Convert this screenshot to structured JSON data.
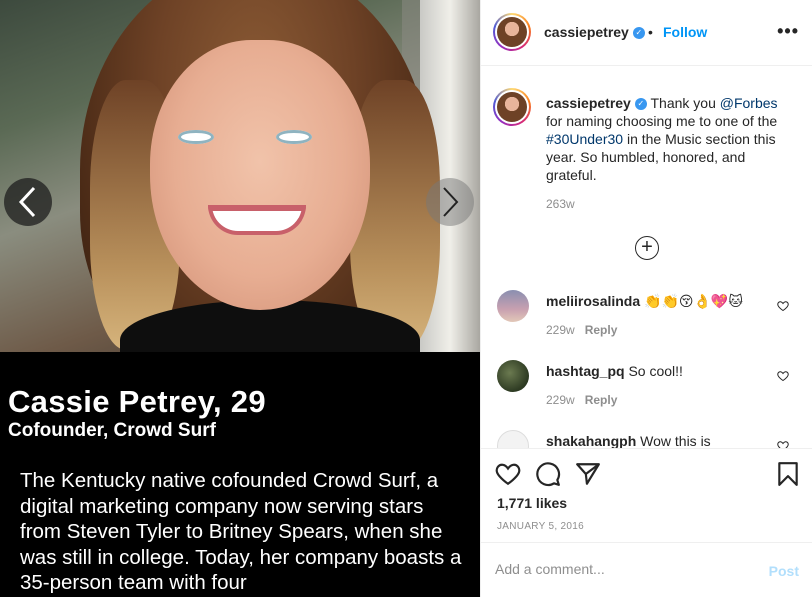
{
  "post": {
    "caption_image": {
      "name": "Cassie Petrey, 29",
      "role": "Cofounder, Crowd Surf",
      "body": "The Kentucky native cofounded Crowd Surf, a digital marketing company now serving stars from Steven Tyler to Britney Spears, when she was still in college. Today, her company boasts a 35-person team with four"
    }
  },
  "header": {
    "username": "cassiepetrey",
    "verified_glyph": "✓",
    "separator": "•",
    "follow_label": "Follow",
    "more_glyph": "•••"
  },
  "caption_comment": {
    "username": "cassiepetrey",
    "text_before": "Thank you ",
    "mention": "@Forbes",
    "text_middle": " for naming choosing me to one of the ",
    "hashtag": "#30Under30",
    "text_after": " in the Music section this year. So humbled, honored, and grateful.",
    "time": "263w"
  },
  "load_more_glyph": "+",
  "comments": [
    {
      "username": "meliirosalinda",
      "text": "👏👏😚👌💖🐱",
      "time": "229w",
      "reply_label": "Reply"
    },
    {
      "username": "hashtag_pq",
      "text": "So cool!!",
      "time": "229w",
      "reply_label": "Reply"
    },
    {
      "username": "shakahangph",
      "text": "Wow this is"
    }
  ],
  "actions": {
    "likes": "1,771 likes",
    "date": "JANUARY 5, 2016"
  },
  "comment_box": {
    "placeholder": "Add a comment...",
    "post_label": "Post"
  },
  "colors": {
    "link": "#00376b",
    "follow": "#0095f6",
    "post_disabled": "#b2dffc"
  }
}
